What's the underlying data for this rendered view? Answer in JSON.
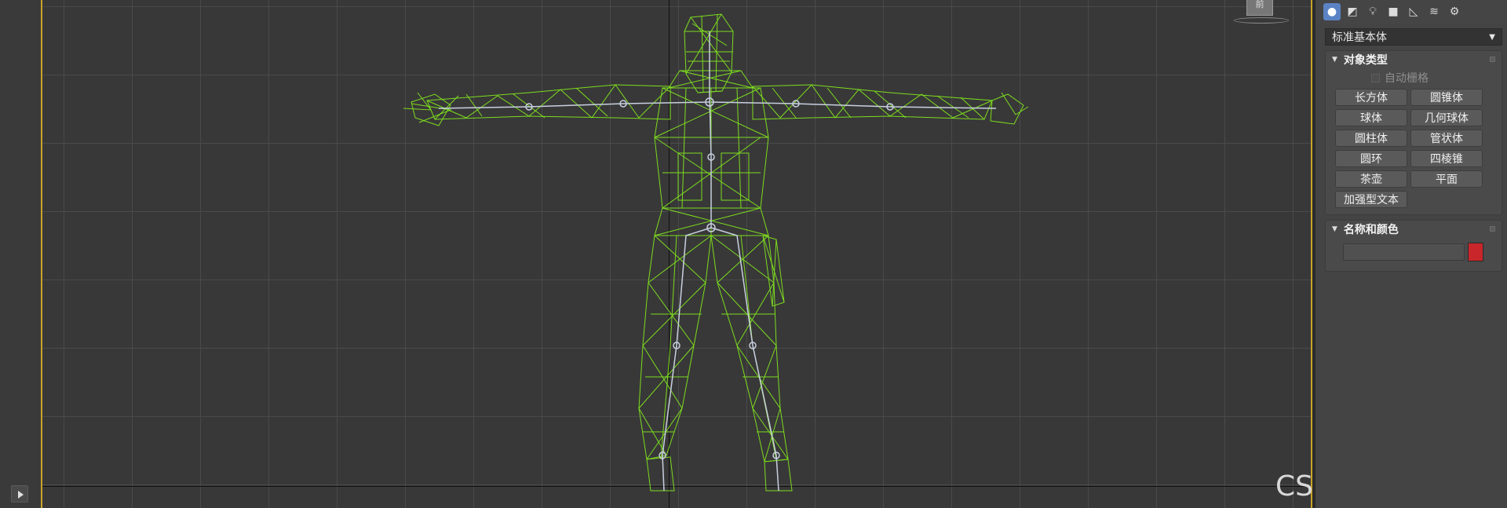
{
  "command_panel": {
    "tabs": [
      {
        "name": "create",
        "icon": "sphere-icon",
        "active": true
      },
      {
        "name": "shapes",
        "icon": "shapes-icon"
      },
      {
        "name": "lights",
        "icon": "light-bulb-icon"
      },
      {
        "name": "cameras",
        "icon": "camera-icon"
      },
      {
        "name": "helpers",
        "icon": "ruler-icon"
      },
      {
        "name": "space-warps",
        "icon": "waves-icon"
      },
      {
        "name": "systems",
        "icon": "gears-icon"
      }
    ],
    "category_dropdown": {
      "selected": "标准基本体"
    },
    "object_type": {
      "title": "对象类型",
      "autogrid_label": "自动栅格",
      "buttons": [
        "长方体",
        "圆锥体",
        "球体",
        "几何球体",
        "圆柱体",
        "管状体",
        "圆环",
        "四棱锥",
        "茶壶",
        "平面",
        "加强型文本"
      ]
    },
    "name_and_color": {
      "title": "名称和颜色",
      "name_value": "",
      "color": "#c8262a"
    }
  },
  "viewport": {
    "viewcube_label": "前",
    "grid_color": "#4a4a4a",
    "wire_color": "#7ddc1f",
    "bone_color": "#c8d0e0"
  },
  "watermark": "CSDN @灵魂学者",
  "colors": {
    "viewport_border": "#c9a227",
    "active_tab": "#5b83c4"
  }
}
